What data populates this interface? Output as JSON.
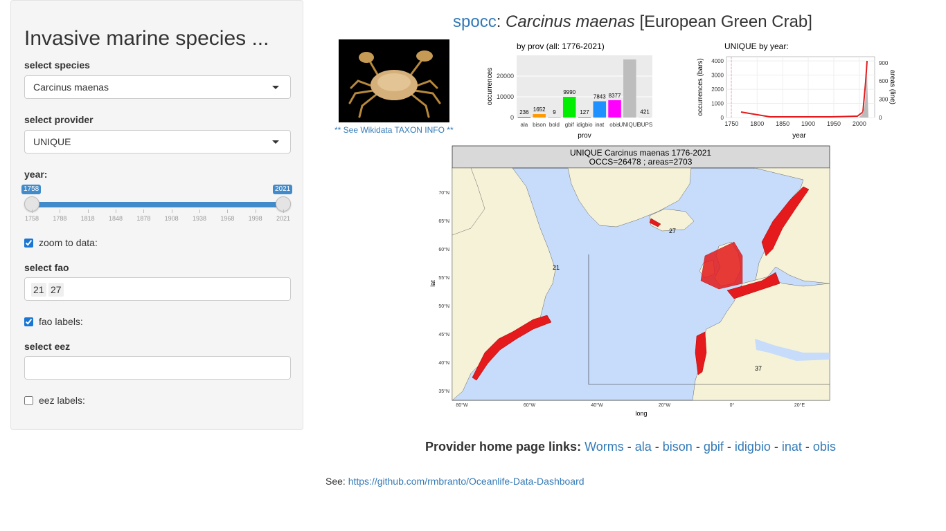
{
  "sidebar": {
    "title": "Invasive marine species ...",
    "species": {
      "label": "select species",
      "value": "Carcinus maenas"
    },
    "provider": {
      "label": "select provider",
      "value": "UNIQUE"
    },
    "year": {
      "label": "year:",
      "min_value": "1758",
      "max_value": "2021",
      "ticks": [
        "1758",
        "1788",
        "1818",
        "1848",
        "1878",
        "1908",
        "1938",
        "1968",
        "1998",
        "2021"
      ]
    },
    "zoom": {
      "label": "zoom to data:",
      "checked": true
    },
    "fao": {
      "label": "select fao",
      "chips": [
        "21",
        "27"
      ]
    },
    "fao_labels": {
      "label": "fao labels:",
      "checked": true
    },
    "eez": {
      "label": "select eez",
      "value": ""
    },
    "eez_labels": {
      "label": "eez labels:",
      "checked": false
    }
  },
  "main": {
    "title_link": "spocc",
    "title_sep": ":",
    "species_italic": "Carcinus maenas",
    "common_name": "[European Green Crab]",
    "wiki_link": "** See Wikidata TAXON INFO **"
  },
  "bar_chart": {
    "title": "by prov  (all: 1776-2021)",
    "xlabel": "prov",
    "ylabel": "occurrences",
    "yticks": [
      "0",
      "10000",
      "20000"
    ],
    "categories": [
      "ala",
      "bison",
      "bold",
      "gbif",
      "idigbio",
      "inat",
      "obis",
      "UNIQUE",
      "DUPS"
    ],
    "values": [
      236,
      1652,
      9,
      9990,
      127,
      7843,
      8377,
      28000,
      421
    ],
    "value_labels": [
      "236",
      "1652",
      "9",
      "9990",
      "127",
      "7843",
      "8377",
      "",
      "421"
    ],
    "colors": [
      "#e41a1c",
      "#ff9900",
      "#cccc00",
      "#00ee00",
      "#00bbbb",
      "#1e90ff",
      "#ff00ff",
      "#bdbdbd",
      "#dddddd"
    ]
  },
  "line_chart": {
    "title": "UNIQUE  by year:",
    "xlabel": "year",
    "ylabel_left": "occurrences (bars)",
    "ylabel_right": "areas (line)",
    "xticks": [
      "1750",
      "1800",
      "1850",
      "1900",
      "1950",
      "2000"
    ],
    "yticks_left": [
      "0",
      "1000",
      "2000",
      "3000",
      "4000"
    ],
    "yticks_right": [
      "0",
      "300",
      "600",
      "900"
    ]
  },
  "map": {
    "header_line1": "UNIQUE Carcinus maenas 1776-2021",
    "header_line2": "OCCS=26478 ; areas=2703",
    "xlabel": "long",
    "ylabel": "lat",
    "lat_ticks": [
      "70°N",
      "65°N",
      "60°N",
      "55°N",
      "50°N",
      "45°N",
      "40°N",
      "35°N"
    ],
    "lon_ticks": [
      "80°W",
      "60°W",
      "40°W",
      "20°W",
      "0°",
      "20°E"
    ],
    "area_labels": [
      "21",
      "27",
      "37"
    ]
  },
  "footer": {
    "provider_label": "Provider home page links:",
    "links": [
      "Worms",
      "ala",
      "bison",
      "gbif",
      "idigbio",
      "inat",
      "obis"
    ],
    "see_label": "See:",
    "repo_link": "https://github.com/rmbranto/Oceanlife-Data-Dashboard"
  }
}
